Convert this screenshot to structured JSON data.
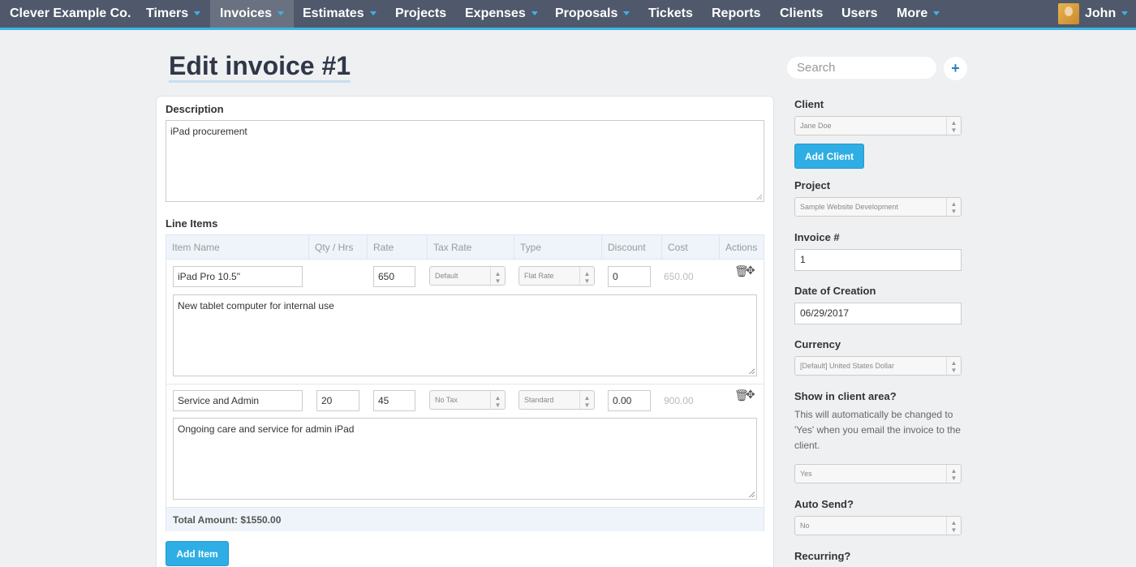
{
  "nav": {
    "brand": "Clever Example Co.",
    "items": [
      {
        "label": "Timers",
        "dropdown": true
      },
      {
        "label": "Invoices",
        "dropdown": true,
        "active": true
      },
      {
        "label": "Estimates",
        "dropdown": true
      },
      {
        "label": "Projects",
        "dropdown": false
      },
      {
        "label": "Expenses",
        "dropdown": true
      },
      {
        "label": "Proposals",
        "dropdown": true
      },
      {
        "label": "Tickets",
        "dropdown": false
      },
      {
        "label": "Reports",
        "dropdown": false
      },
      {
        "label": "Clients",
        "dropdown": false
      },
      {
        "label": "Users",
        "dropdown": false
      },
      {
        "label": "More",
        "dropdown": true
      }
    ],
    "user": "John"
  },
  "page": {
    "title": "Edit invoice #1"
  },
  "form": {
    "description_label": "Description",
    "description_value": "iPad procurement",
    "line_items_label": "Line Items",
    "columns": [
      "Item Name",
      "Qty / Hrs",
      "Rate",
      "Tax Rate",
      "Type",
      "Discount",
      "Cost",
      "Actions"
    ],
    "items": [
      {
        "name": "iPad Pro 10.5\"",
        "qty": "",
        "rate": "650",
        "tax_rate": "Default",
        "type": "Flat Rate",
        "discount": "0",
        "cost": "650.00",
        "details": "New tablet computer for internal use"
      },
      {
        "name": "Service and Admin",
        "qty": "20",
        "rate": "45",
        "tax_rate": "No Tax",
        "type": "Standard",
        "discount": "0.00",
        "cost": "900.00",
        "details": "Ongoing care and service for admin iPad"
      }
    ],
    "total": "Total Amount: $1550.00",
    "add_item_label": "Add Item"
  },
  "sidebar": {
    "search_placeholder": "Search",
    "plus_label": "+",
    "client_label": "Client",
    "client_value": "Jane Doe",
    "add_client_label": "Add Client",
    "project_label": "Project",
    "project_value": "Sample Website Development",
    "invoice_number_label": "Invoice #",
    "invoice_number_value": "1",
    "date_label": "Date of Creation",
    "date_value": "06/29/2017",
    "currency_label": "Currency",
    "currency_value": "[Default] United States Dollar",
    "show_client_label": "Show in client area?",
    "show_client_help": "This will automatically be changed to 'Yes' when you email the invoice to the client.",
    "show_client_value": "Yes",
    "auto_send_label": "Auto Send?",
    "auto_send_value": "No",
    "recurring_label": "Recurring?"
  },
  "colors": {
    "nav_bg": "#50596b",
    "accent": "#3cb4e5",
    "button": "#2eaee4"
  }
}
